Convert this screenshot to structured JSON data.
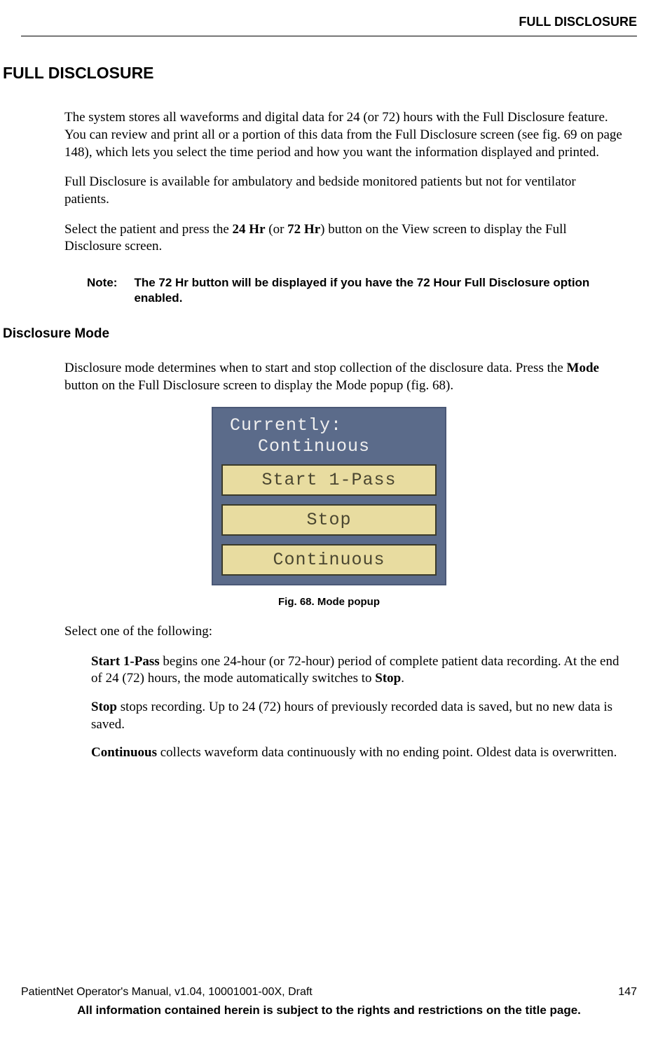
{
  "header": {
    "running_title": "FULL DISCLOSURE"
  },
  "section": {
    "title": "FULL DISCLOSURE",
    "para1": "The system stores all waveforms and digital data for 24 (or 72) hours with the Full Disclosure feature. You can review and print all or a portion of this data from the Full Disclosure screen (see fig. 69 on page 148), which lets you select the time period and how you want the information displayed and printed.",
    "para2": "Full Disclosure is available for ambulatory and bedside monitored patients but not for ventilator patients.",
    "para3_a": "Select the patient and press the ",
    "para3_b": "24 Hr",
    "para3_c": " (or ",
    "para3_d": "72 Hr",
    "para3_e": ") button on the View screen to display the Full Disclosure screen.",
    "note_label": "Note:",
    "note_text": "The 72 Hr button will be displayed if you have the 72 Hour Full Disclosure option enabled."
  },
  "subsection": {
    "title": "Disclosure Mode",
    "para1_a": "Disclosure mode determines when to start and stop collection of the disclosure data. Press the ",
    "para1_b": "Mode",
    "para1_c": " button on the Full Disclosure screen to display the Mode popup (fig. 68)."
  },
  "mode_popup": {
    "header_line1": "Currently:",
    "header_line2": "Continuous",
    "buttons": [
      "Start 1-Pass",
      "Stop",
      "Continuous"
    ]
  },
  "figure": {
    "caption": "Fig. 68. Mode popup"
  },
  "options": {
    "intro": "Select one of the following:",
    "opt1_b": "Start 1-Pass",
    "opt1_t": " begins one 24-hour (or 72-hour) period of complete patient data recording. At the end of 24 (72) hours, the mode automatically switches to ",
    "opt1_b2": "Stop",
    "opt1_end": ".",
    "opt2_b": "Stop",
    "opt2_t": " stops recording. Up to 24 (72) hours of previously recorded data is saved, but no new data is saved.",
    "opt3_b": "Continuous",
    "opt3_t": " collects waveform data continuously with no ending point. Oldest data is overwritten."
  },
  "footer": {
    "left": "PatientNet Operator's Manual, v1.04, 10001001-00X, Draft",
    "right": "147",
    "notice": "All information contained herein is subject to the rights and restrictions on the title page."
  }
}
